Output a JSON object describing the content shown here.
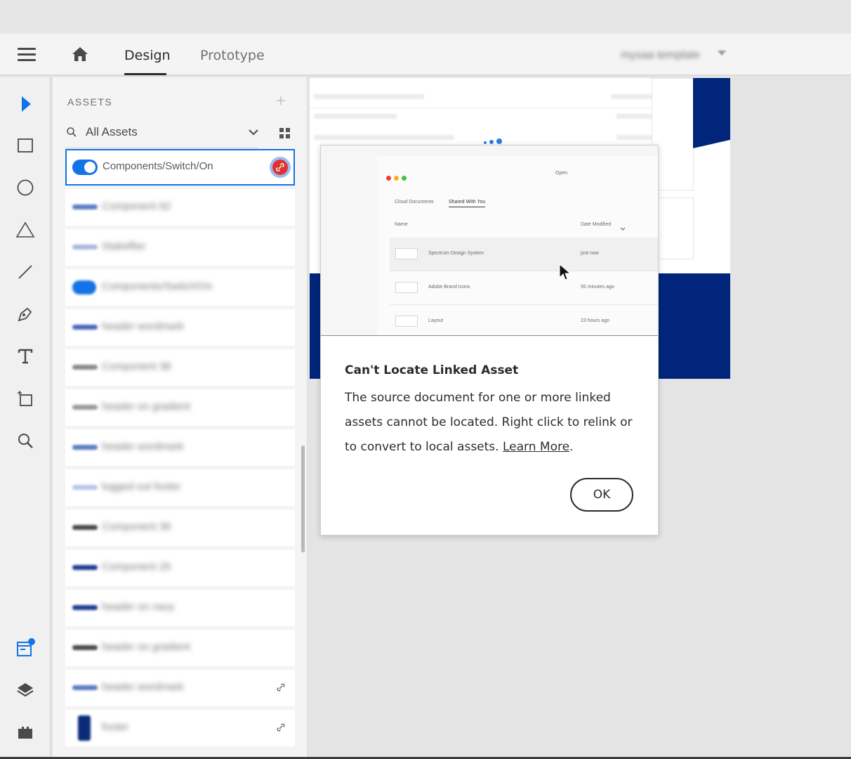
{
  "header": {
    "tabs": [
      {
        "label": "Design",
        "active": true
      },
      {
        "label": "Prototype",
        "active": false
      }
    ],
    "document_title": "mysaa template"
  },
  "toolbar": {
    "tools": [
      "select-icon",
      "rectangle-icon",
      "ellipse-icon",
      "triangle-icon",
      "line-icon",
      "pen-icon",
      "text-icon",
      "artboard-icon",
      "zoom-icon"
    ],
    "bottom": [
      "assets-icon",
      "layers-icon",
      "plugins-icon"
    ],
    "accent": "#1473e6"
  },
  "assets": {
    "title": "ASSETS",
    "filter": "All Assets",
    "selected_item": "Components/Switch/On",
    "items": [
      {
        "name": "Component 62",
        "color": "#5b7bc4"
      },
      {
        "name": "Stakeflier",
        "color": "#a9b8e0"
      },
      {
        "name": "Components/Switch/On",
        "color": "#1473e6",
        "toggle": true
      },
      {
        "name": "header wordmark",
        "color": "#4a66b8"
      },
      {
        "name": "Component 38",
        "color": "#8a8a8a"
      },
      {
        "name": "header on gradient",
        "color": "#9a9a9a"
      },
      {
        "name": "header wordmark",
        "color": "#5b7bc4"
      },
      {
        "name": "logged out footer",
        "color": "#b8c6ec"
      },
      {
        "name": "Component 36",
        "color": "#4a4a4a"
      },
      {
        "name": "Component 25",
        "color": "#1d3c8f"
      },
      {
        "name": "header on navy",
        "color": "#1d3c8f"
      },
      {
        "name": "header on gradient",
        "color": "#4a4a4a"
      },
      {
        "name": "header wordmark",
        "color": "#5b7bc4",
        "linked": true
      },
      {
        "name": "footer",
        "color": "#0a2b78",
        "linked": true
      }
    ]
  },
  "preview": {
    "window_title": "Open",
    "tabs": [
      "Cloud Documents",
      "Shared With You"
    ],
    "columns": [
      "Name",
      "Date Modified"
    ],
    "rows": [
      {
        "name": "Spectrum Design System",
        "date": "just now"
      },
      {
        "name": "Adobe Brand Icons",
        "date": "55 minutes ago"
      },
      {
        "name": "Layout",
        "date": "23 hours ago"
      }
    ]
  },
  "dialog": {
    "title": "Can't Locate Linked Asset",
    "body": "The source document for one or more linked assets cannot be located. Right click to relink or to convert to local assets.",
    "link_label": "Learn More",
    "link_suffix": ".",
    "ok_label": "OK"
  }
}
